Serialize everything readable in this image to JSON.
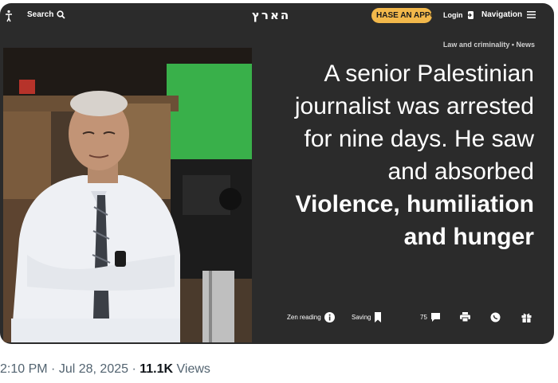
{
  "header": {
    "search_label": "Search",
    "logo_text": "הארץ",
    "cta_label": "HASE AN APPOI",
    "login_label": "Login",
    "nav_label": "Navigation"
  },
  "breadcrumb": "Law and criminality • News",
  "headline": {
    "light": "A senior Palestinian journalist was arrested for nine days. He saw and absorbed",
    "bold": "Violence, humiliation and hunger"
  },
  "toolbar": {
    "zen_label": "Zen reading",
    "saving_label": "Saving",
    "comments_count": "75"
  },
  "tweet_meta": {
    "time": "2:10 PM",
    "sep1": "·",
    "date": "Jul 28, 2025",
    "sep2": "·",
    "views_count": "11.1K",
    "views_label": "Views"
  },
  "colors": {
    "card_bg": "#2b2b2b",
    "cta_bg": "#f2b84b",
    "meta_gray": "#536471"
  }
}
